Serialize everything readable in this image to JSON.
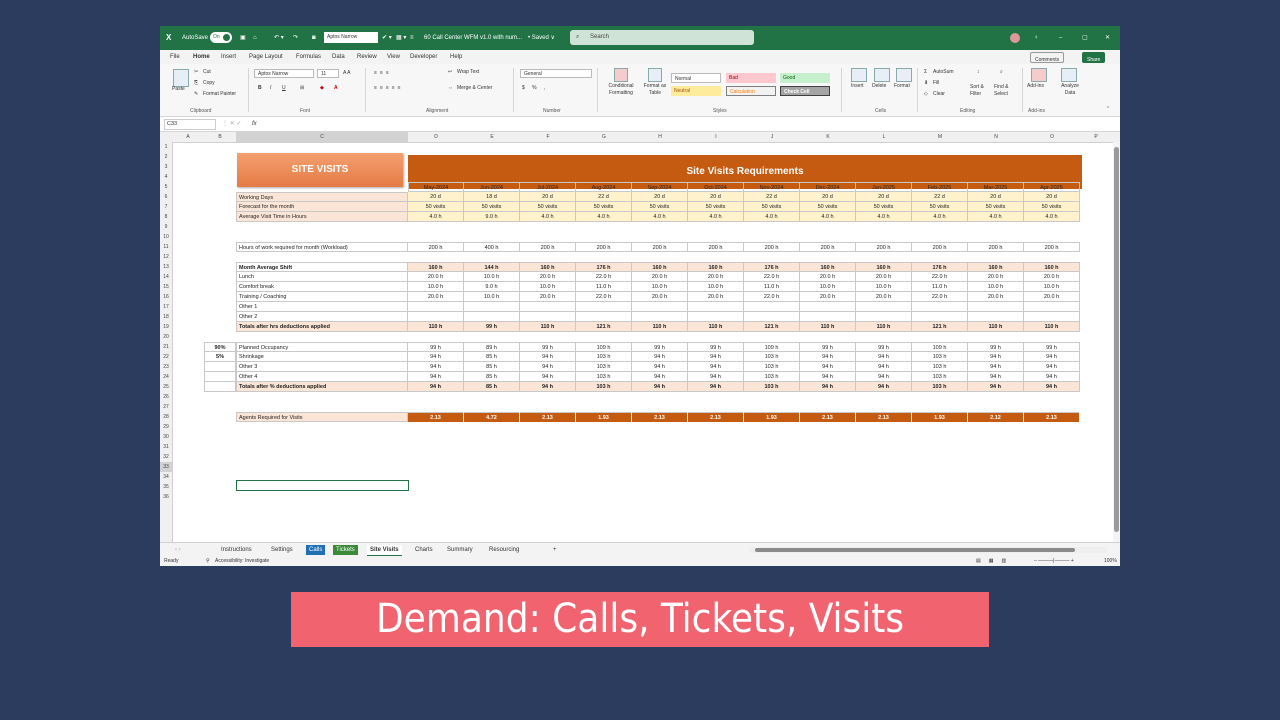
{
  "titlebar": {
    "autosave_label": "AutoSave",
    "autosave_state": "On",
    "font_name": "Aptos Narrow",
    "doc_title": "60 Call Center WFM v1.0 with num...",
    "saved": "• Saved ∨",
    "search_placeholder": "Search",
    "minimize": "–",
    "maximize": "▢",
    "close": "✕"
  },
  "menu": {
    "items": [
      "File",
      "Home",
      "Insert",
      "Page Layout",
      "Formulas",
      "Data",
      "Review",
      "View",
      "Developer",
      "Help"
    ],
    "comments": "Comments",
    "share": "Share"
  },
  "ribbon": {
    "paste": "Paste",
    "cut": "Cut",
    "copy": "Copy",
    "format_painter": "Format Painter",
    "clipboard": "Clipboard",
    "font_name": "Aptos Narrow",
    "font_size": "11",
    "font_group": "Font",
    "wrap_text": "Wrap Text",
    "merge_center": "Merge & Center",
    "alignment": "Alignment",
    "number_format": "General",
    "number": "Number",
    "conditional_formatting": "Conditional Formatting",
    "format_as_table": "Format as Table",
    "style_normal": "Normal",
    "style_bad": "Bad",
    "style_good": "Good",
    "style_neutral": "Neutral",
    "style_calculation": "Calculation",
    "style_check": "Check Cell",
    "styles": "Styles",
    "insert": "Insert",
    "delete": "Delete",
    "format": "Format",
    "cells": "Cells",
    "autosum": "AutoSum",
    "fill": "Fill",
    "clear": "Clear",
    "sort_filter": "Sort & Filter",
    "find_select": "Find & Select",
    "editing": "Editing",
    "addins": "Add-ins",
    "analyze_data": "Analyze Data",
    "addins_group": "Add-ins"
  },
  "formula_bar": {
    "name_box": "C33",
    "fx": "fx",
    "value": ""
  },
  "columns": [
    "A",
    "B",
    "C",
    "D",
    "E",
    "F",
    "G",
    "H",
    "I",
    "J",
    "K",
    "L",
    "M",
    "N",
    "O",
    "P"
  ],
  "rows": [
    "1",
    "2",
    "3",
    "4",
    "5",
    "6",
    "7",
    "8",
    "9",
    "10",
    "11",
    "12",
    "13",
    "14",
    "15",
    "16",
    "17",
    "18",
    "19",
    "20",
    "21",
    "22",
    "23",
    "24",
    "25",
    "26",
    "27",
    "28",
    "29",
    "30",
    "31",
    "32",
    "33",
    "34",
    "35",
    "36"
  ],
  "sheet": {
    "site_visits_title": "SITE VISITS",
    "requirements_title": "Site Visits Requirements",
    "months": [
      "May-2024",
      "Jun-2024",
      "Jul-2024",
      "Aug-2024",
      "Sep-2024",
      "Oct-2024",
      "Nov-2024",
      "Dec-2024",
      "Jan-2025",
      "Feb-2025",
      "Mar-2025",
      "Apr-2025"
    ],
    "r6": {
      "label": "Working Days",
      "values": [
        "20 d",
        "18 d",
        "20 d",
        "22 d",
        "20 d",
        "20 d",
        "22 d",
        "20 d",
        "20 d",
        "22 d",
        "20 d",
        "20 d"
      ]
    },
    "r7": {
      "label": "Forecast for the month",
      "values": [
        "50  visits",
        "50  visits",
        "50  visits",
        "50  visits",
        "50  visits",
        "50  visits",
        "50  visits",
        "50  visits",
        "50  visits",
        "50  visits",
        "50  visits",
        "50  visits"
      ]
    },
    "r8": {
      "label": "Average Visit Time in Hours",
      "values": [
        "4.0 h",
        "9.0 h",
        "4.0 h",
        "4.0 h",
        "4.0 h",
        "4.0 h",
        "4.0 h",
        "4.0 h",
        "4.0 h",
        "4.0 h",
        "4.0 h",
        "4.0 h"
      ]
    },
    "r11": {
      "label": "Hours of work required for month (Workload)",
      "values": [
        "200 h",
        "400 h",
        "200 h",
        "200 h",
        "200 h",
        "200 h",
        "200 h",
        "200 h",
        "200 h",
        "200 h",
        "200 h",
        "200 h"
      ]
    },
    "r13": {
      "label": "Month Average Shift",
      "values": [
        "160 h",
        "144 h",
        "160 h",
        "176 h",
        "160 h",
        "160 h",
        "176 h",
        "160 h",
        "160 h",
        "176 h",
        "160 h",
        "160 h"
      ]
    },
    "r14": {
      "label": "Lunch",
      "values": [
        "20.0 h",
        "10.0 h",
        "20.0 h",
        "22.0 h",
        "20.0 h",
        "20.0 h",
        "22.0 h",
        "20.0 h",
        "20.0 h",
        "22.0 h",
        "20.0 h",
        "20.0 h"
      ]
    },
    "r15": {
      "label": "Comfort break",
      "values": [
        "10.0 h",
        "9.0 h",
        "10.0 h",
        "11.0 h",
        "10.0 h",
        "10.0 h",
        "11.0 h",
        "10.0 h",
        "10.0 h",
        "11.0 h",
        "10.0 h",
        "10.0 h"
      ]
    },
    "r16": {
      "label": "Training / Coaching",
      "values": [
        "20.0 h",
        "10.0 h",
        "20.0 h",
        "22.0 h",
        "20.0 h",
        "20.0 h",
        "22.0 h",
        "20.0 h",
        "20.0 h",
        "22.0 h",
        "20.0 h",
        "20.0 h"
      ]
    },
    "r17": {
      "label": "Other 1",
      "values": [
        "",
        "",
        "",
        "",
        "",
        "",
        "",
        "",
        "",
        "",
        "",
        ""
      ]
    },
    "r18": {
      "label": "Other 2",
      "values": [
        "",
        "",
        "",
        "",
        "",
        "",
        "",
        "",
        "",
        "",
        "",
        ""
      ]
    },
    "r19": {
      "label": "Totals after hrs deductions applied",
      "values": [
        "110 h",
        "99 h",
        "110 h",
        "121 h",
        "110 h",
        "110 h",
        "121 h",
        "110 h",
        "110 h",
        "121 h",
        "110 h",
        "110 h"
      ]
    },
    "r21": {
      "pct": "90%",
      "label": "Planned Occupancy",
      "values": [
        "99 h",
        "89 h",
        "99 h",
        "109 h",
        "99 h",
        "99 h",
        "109 h",
        "99 h",
        "99 h",
        "109 h",
        "99 h",
        "99 h"
      ]
    },
    "r22": {
      "pct": "5%",
      "label": "Shrinkage",
      "values": [
        "94 h",
        "85 h",
        "94 h",
        "103 h",
        "94 h",
        "94 h",
        "103 h",
        "94 h",
        "94 h",
        "103 h",
        "94 h",
        "94 h"
      ]
    },
    "r23": {
      "pct": "",
      "label": "Other 3",
      "values": [
        "94 h",
        "85 h",
        "94 h",
        "103 h",
        "94 h",
        "94 h",
        "103 h",
        "94 h",
        "94 h",
        "103 h",
        "94 h",
        "94 h"
      ]
    },
    "r24": {
      "pct": "",
      "label": "Other 4",
      "values": [
        "94 h",
        "85 h",
        "94 h",
        "103 h",
        "94 h",
        "94 h",
        "103 h",
        "94 h",
        "94 h",
        "103 h",
        "94 h",
        "94 h"
      ]
    },
    "r25": {
      "pct": "",
      "label": "Totals after % deductions applied",
      "values": [
        "94 h",
        "85 h",
        "94 h",
        "103 h",
        "94 h",
        "94 h",
        "103 h",
        "94 h",
        "94 h",
        "103 h",
        "94 h",
        "94 h"
      ]
    },
    "r28": {
      "label": "Agents Required for Visits",
      "values": [
        "2.13",
        "4.72",
        "2.13",
        "1.93",
        "2.13",
        "2.13",
        "1.93",
        "2.13",
        "2.13",
        "1.93",
        "2.12",
        "2.13"
      ]
    }
  },
  "tabs": [
    "Instructions",
    "Settings",
    "Calls",
    "Tickets",
    "Site Visits",
    "Charts",
    "Summary",
    "Resourcing"
  ],
  "tab_colors": {
    "Calls": "#1f6fb5",
    "Tickets": "#3a8a3a"
  },
  "status": {
    "ready": "Ready",
    "accessibility": "Accessibility: Investigate",
    "zoom": "100%"
  },
  "caption": "Demand: Calls, Tickets, Visits"
}
